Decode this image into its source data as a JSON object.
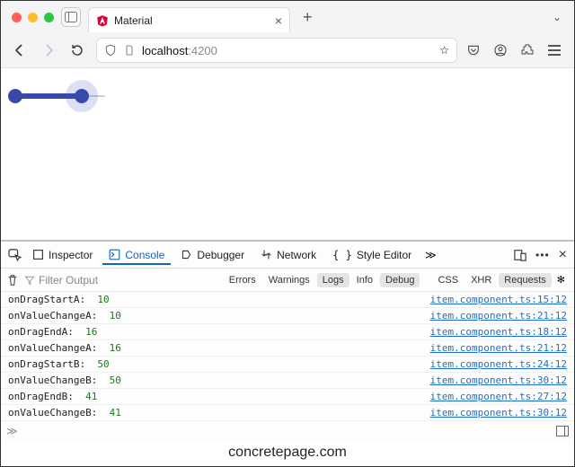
{
  "window": {
    "traffic": {
      "close": "#ff5f57",
      "min": "#febc2e",
      "max": "#28c840"
    },
    "tab_title": "Material",
    "url_prefix": "localhost",
    "url_suffix": ":4200"
  },
  "slider": {
    "low": 10,
    "high": 50,
    "trackWidth": 110,
    "fillLeft": 12,
    "fillWidth": 78,
    "thumbA": 6,
    "thumbB": 80
  },
  "devtools": {
    "tabs": {
      "inspector": "Inspector",
      "console": "Console",
      "debugger": "Debugger",
      "network": "Network",
      "styleeditor": "Style Editor"
    },
    "filter_placeholder": "Filter Output",
    "levels": {
      "errors": "Errors",
      "warnings": "Warnings",
      "logs": "Logs",
      "info": "Info",
      "debug": "Debug"
    },
    "xhr": {
      "css": "CSS",
      "xhr": "XHR",
      "requests": "Requests"
    },
    "console": [
      {
        "label": "onDragStartA:",
        "value": "10",
        "src": "item.component.ts:15:12"
      },
      {
        "label": "onValueChangeA:",
        "value": "10",
        "src": "item.component.ts:21:12"
      },
      {
        "label": "onDragEndA:",
        "value": "16",
        "src": "item.component.ts:18:12"
      },
      {
        "label": "onValueChangeA:",
        "value": "16",
        "src": "item.component.ts:21:12"
      },
      {
        "label": "onDragStartB:",
        "value": "50",
        "src": "item.component.ts:24:12"
      },
      {
        "label": "onValueChangeB:",
        "value": "50",
        "src": "item.component.ts:30:12"
      },
      {
        "label": "onDragEndB:",
        "value": "41",
        "src": "item.component.ts:27:12"
      },
      {
        "label": "onValueChangeB:",
        "value": "41",
        "src": "item.component.ts:30:12"
      }
    ]
  },
  "footer": "concretepage.com"
}
